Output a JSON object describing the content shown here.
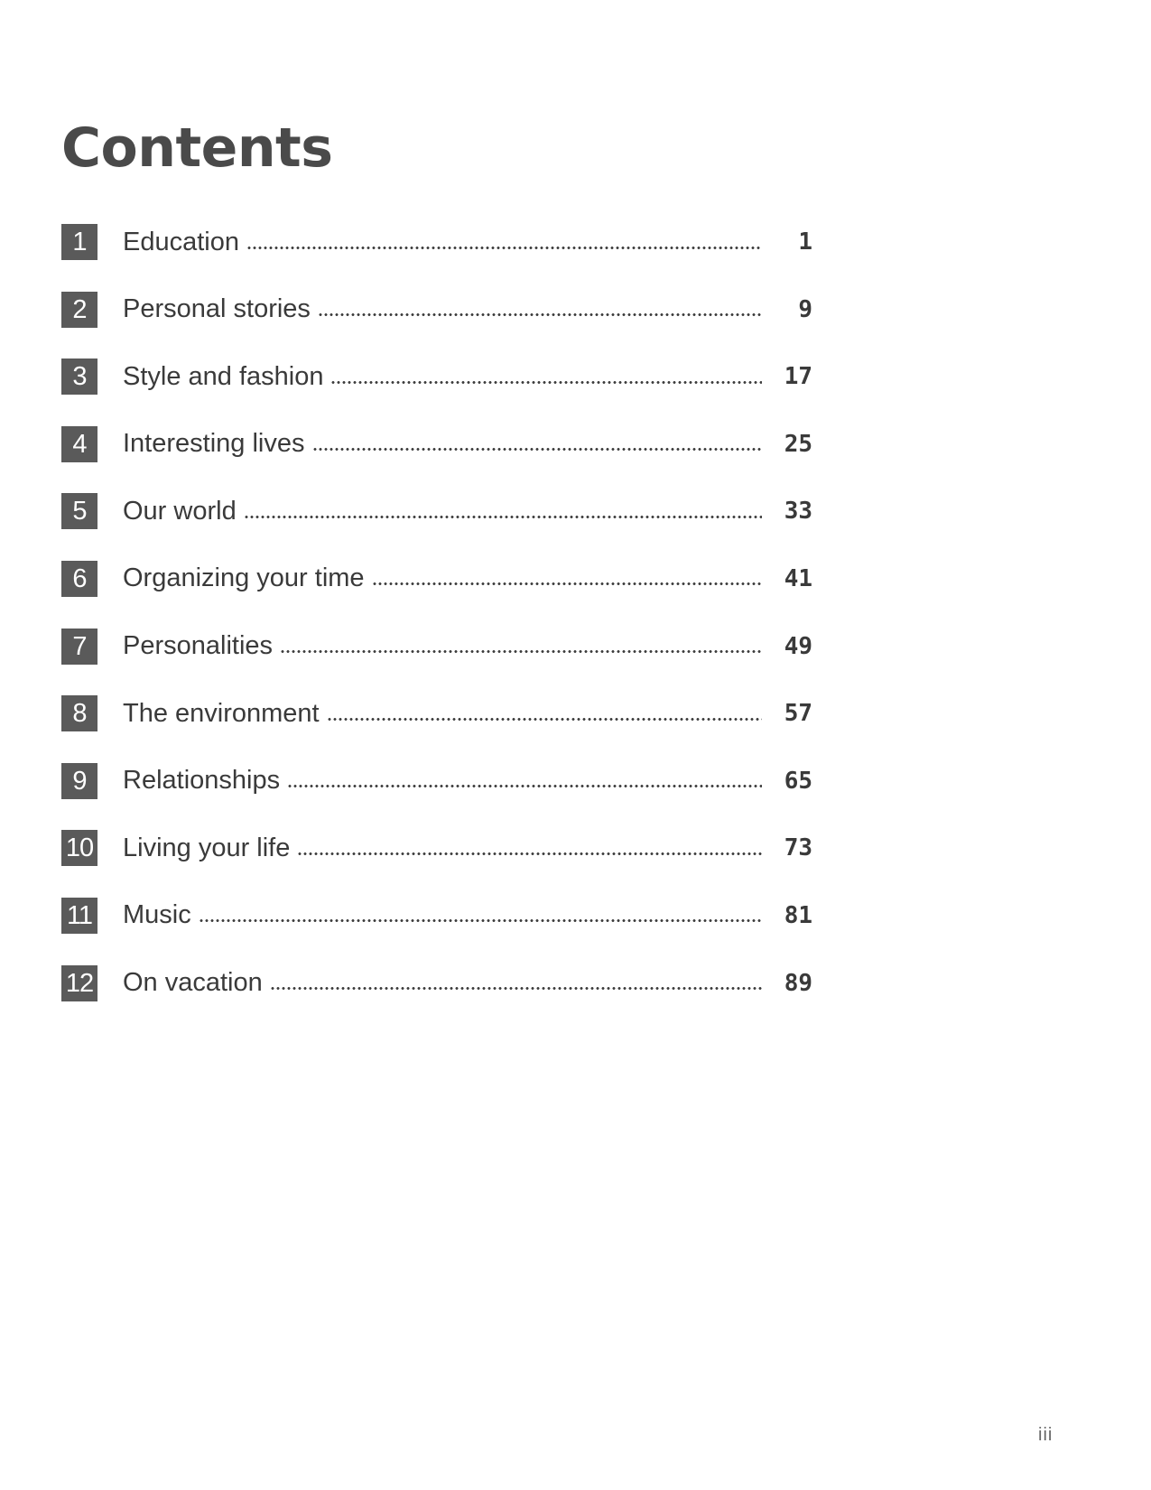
{
  "page": {
    "title": "Contents",
    "folio": "iii"
  },
  "toc": {
    "entries": [
      {
        "number": "1",
        "title": "Education",
        "page": "1"
      },
      {
        "number": "2",
        "title": "Personal stories",
        "page": "9"
      },
      {
        "number": "3",
        "title": "Style and fashion",
        "page": "17"
      },
      {
        "number": "4",
        "title": "Interesting lives",
        "page": "25"
      },
      {
        "number": "5",
        "title": "Our world",
        "page": "33"
      },
      {
        "number": "6",
        "title": "Organizing your time",
        "page": "41"
      },
      {
        "number": "7",
        "title": "Personalities",
        "page": "49"
      },
      {
        "number": "8",
        "title": "The environment",
        "page": "57"
      },
      {
        "number": "9",
        "title": "Relationships",
        "page": "65"
      },
      {
        "number": "10",
        "title": "Living your life",
        "page": "73"
      },
      {
        "number": "11",
        "title": "Music",
        "page": "81"
      },
      {
        "number": "12",
        "title": "On vacation",
        "page": "89"
      }
    ]
  },
  "colors": {
    "badge_background": "#5a5a5a",
    "badge_text": "#ffffff",
    "text": "#3a3a3a"
  }
}
